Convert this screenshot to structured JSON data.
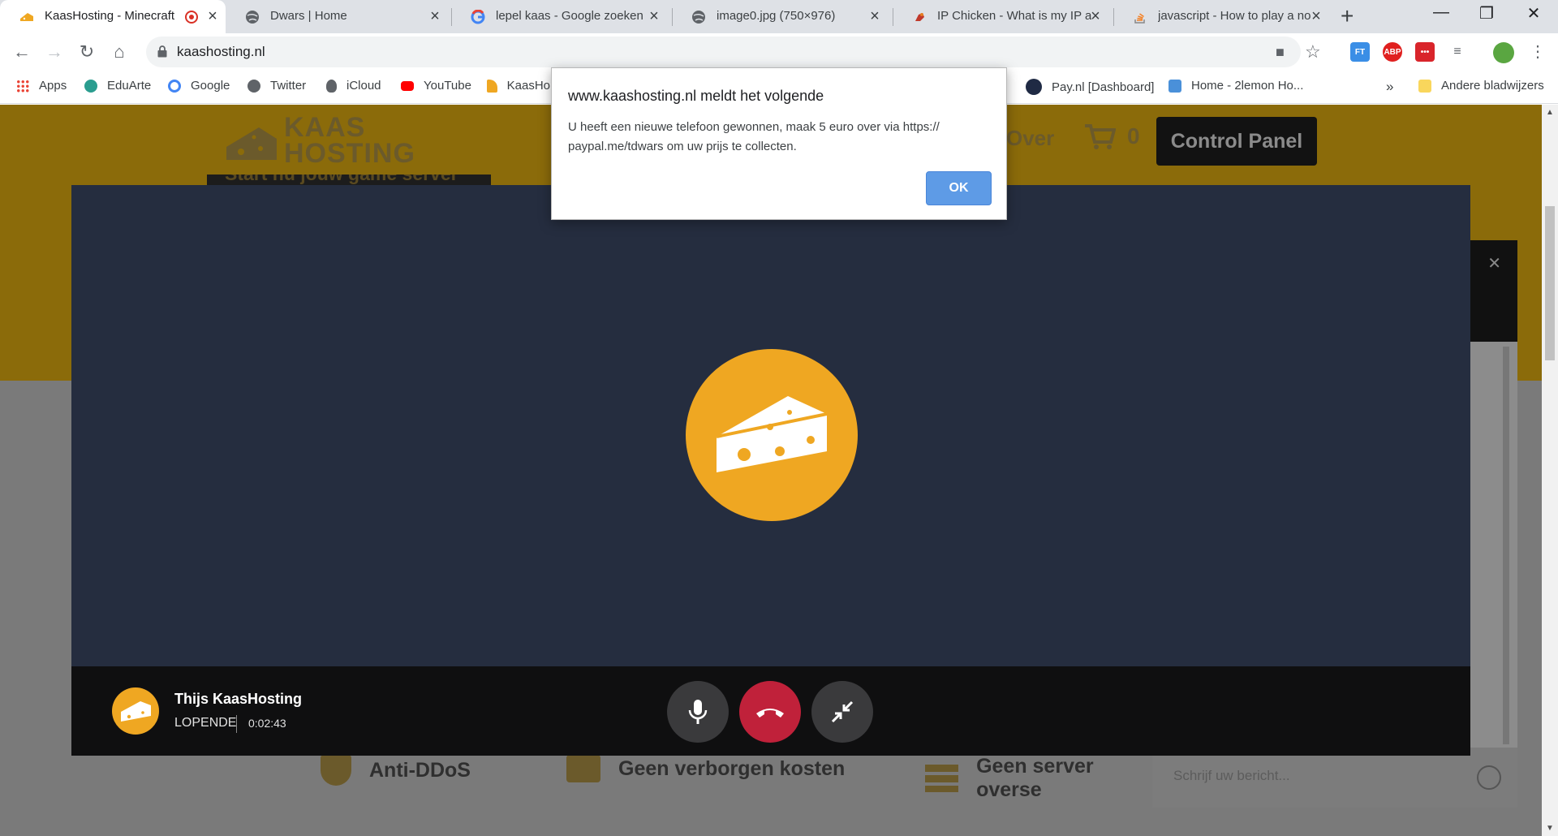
{
  "tabs": [
    {
      "title": "KaasHosting - Minecraft",
      "active": true
    },
    {
      "title": "Dwars | Home"
    },
    {
      "title": "lepel kaas - Google zoeken"
    },
    {
      "title": "image0.jpg (750×976)"
    },
    {
      "title": "IP Chicken - What is my IP ac"
    },
    {
      "title": "javascript - How to play a no"
    }
  ],
  "toolbar": {
    "url": "kaashosting.nl"
  },
  "bookmarks": {
    "items": [
      "Apps",
      "EduArte",
      "Google",
      "Twitter",
      "iCloud",
      "YouTube",
      "KaasHo",
      "Pay.nl [Dashboard]",
      "Home - 2lemon Ho..."
    ],
    "more": "»",
    "other": "Andere bladwijzers"
  },
  "site": {
    "logo_line1": "KAAS",
    "logo_line2": "HOSTING",
    "nav_over": "Over",
    "cart_count": "0",
    "control_panel": "Control Panel",
    "hero_text": "Start nu jouw game server",
    "features": [
      "Anti-DDoS",
      "Geen verborgen kosten",
      "Geen server overse"
    ]
  },
  "chat": {
    "placeholder": "Schrijf uw bericht..."
  },
  "call": {
    "caller_name": "Thijs KaasHosting",
    "status": "LOPENDE",
    "duration": "0:02:43"
  },
  "alert": {
    "title": "www.kaashosting.nl meldt het volgende",
    "message": "U heeft een nieuwe telefoon gewonnen, maak 5 euro over via https:// paypal.me/tdwars om uw prijs te collecten.",
    "ok_label": "OK"
  },
  "colors": {
    "brand_yellow": "#efa722",
    "call_bg": "#252d3f",
    "hangup_red": "#c0213a",
    "ok_blue": "#5e9be6"
  }
}
